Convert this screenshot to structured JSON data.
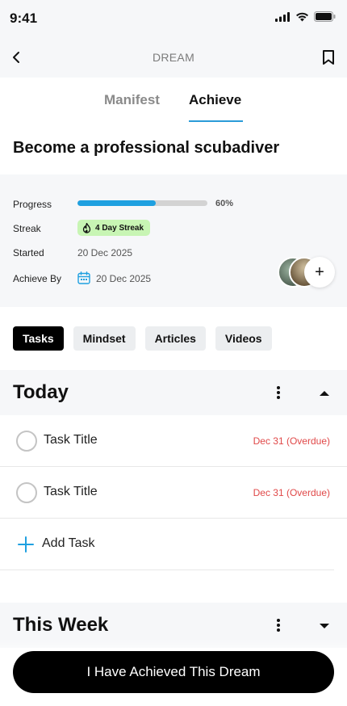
{
  "status_bar": {
    "time": "9:41"
  },
  "nav": {
    "title": "DREAM",
    "back_icon": "chevron-left-icon",
    "bookmark_icon": "bookmark-icon"
  },
  "segments": {
    "manifest": "Manifest",
    "achieve": "Achieve",
    "active": "Achieve"
  },
  "dream": {
    "title": "Become a professional scubadiver"
  },
  "details": {
    "progress_label": "Progress",
    "progress_value": 0.6,
    "progress_text": "60%",
    "streak_label": "Streak",
    "streak_text": "4 Day Streak",
    "started_label": "Started",
    "started_value": "20 Dec 2025",
    "achieve_by_label": "Achieve By",
    "achieve_by_value": "20 Dec 2025"
  },
  "filters": [
    "Tasks",
    "Mindset",
    "Articles",
    "Videos"
  ],
  "active_filter": "Tasks",
  "today": {
    "heading": "Today",
    "tasks": [
      {
        "title": "Task Title",
        "due": "Dec 31 (Overdue)"
      },
      {
        "title": "Task Title",
        "due": "Dec 31 (Overdue)"
      }
    ],
    "add_task_label": "Add Task"
  },
  "this_week": {
    "heading": "This Week"
  },
  "cta_label": "I Have Achieved This Dream",
  "colors": {
    "accent": "#1fa0e0",
    "overdue": "#e04848",
    "streak_bg": "#c8f5b4",
    "primary": "#000000"
  }
}
